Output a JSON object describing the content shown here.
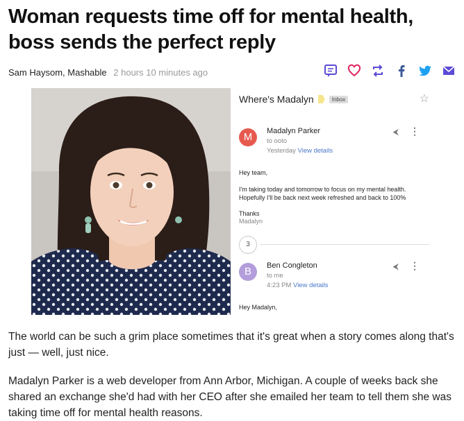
{
  "article": {
    "headline": "Woman requests time off for mental health, boss sends the perfect reply",
    "author": "Sam Haysom,",
    "publisher": "Mashable",
    "time": "2 hours 10 minutes ago",
    "paragraphs": [
      "The world can be such a grim place sometimes that it's great when a story comes along that's just — well, just nice.",
      "Madalyn Parker is a web developer from Ann Arbor, Michigan. A couple of weeks back she shared an exchange she'd had with her CEO after she emailed her team to tell them she was taking time off for mental health reasons."
    ]
  },
  "share_icons": [
    "comment-icon",
    "heart-icon",
    "retweet-icon",
    "facebook-icon",
    "twitter-icon",
    "email-icon"
  ],
  "colors": {
    "share_purple": "#5b4bd5",
    "share_blue": "#1da1f2",
    "avatar_m": "#e65a4f",
    "avatar_b": "#b39ddb",
    "link": "#4a78c9"
  },
  "email": {
    "subject": "Where's Madalyn",
    "label": "Inbox",
    "thread_count": "3",
    "messages": [
      {
        "avatar_letter": "M",
        "sender": "Madalyn Parker",
        "to": "to ooto",
        "date": "Yesterday",
        "details_link": "View details",
        "greeting": "Hey team,",
        "body": "I'm taking today and tomorrow to focus on my mental health. Hopefully I'll be back next week refreshed and back to 100%",
        "signoff": "Thanks",
        "signer": "Madalyn"
      },
      {
        "avatar_letter": "B",
        "sender": "Ben Congleton",
        "to": "to me",
        "date": "4:23 PM",
        "details_link": "View details",
        "greeting": "Hey Madalyn,"
      }
    ]
  }
}
